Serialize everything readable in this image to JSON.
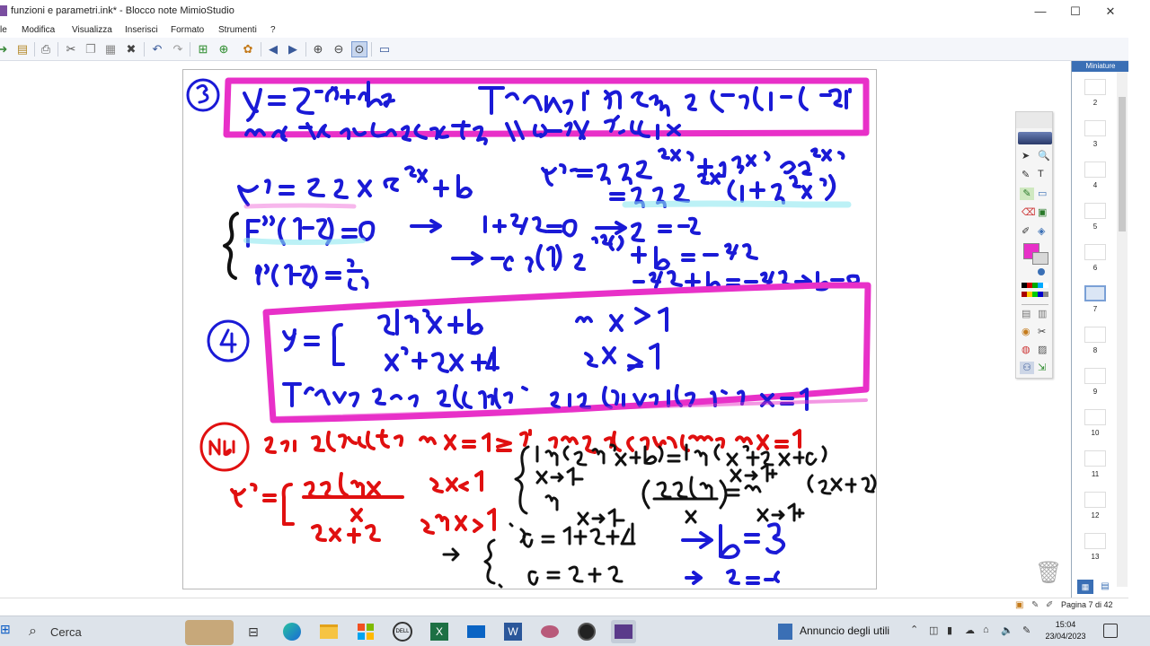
{
  "window": {
    "title": "funzioni e parametri.ink* - Blocco note MimioStudio",
    "minimize": "—",
    "maximize": "☐",
    "close": "✕"
  },
  "menu": [
    "le",
    "Modifica",
    "Visualizza",
    "Inserisci",
    "Formato",
    "Strumenti",
    "?"
  ],
  "thumbnails": {
    "header": "Miniature",
    "pages": [
      "2",
      "3",
      "4",
      "5",
      "6",
      "7",
      "8",
      "9",
      "10",
      "11",
      "12",
      "13"
    ],
    "selected": "7"
  },
  "status": {
    "page_label": "Pagina 7 di 42"
  },
  "taskbar": {
    "search_placeholder": "Cerca",
    "notification": "Annuncio degli utili",
    "time": "15:04",
    "date": "23/04/2023"
  },
  "colors": {
    "ink_blue": "#1a1ad6",
    "ink_red": "#e01010",
    "ink_black": "#111111",
    "highlight_magenta": "#e830c8",
    "highlight_cyan": "#8fe8f0",
    "taskbar": "#dde3ea"
  }
}
